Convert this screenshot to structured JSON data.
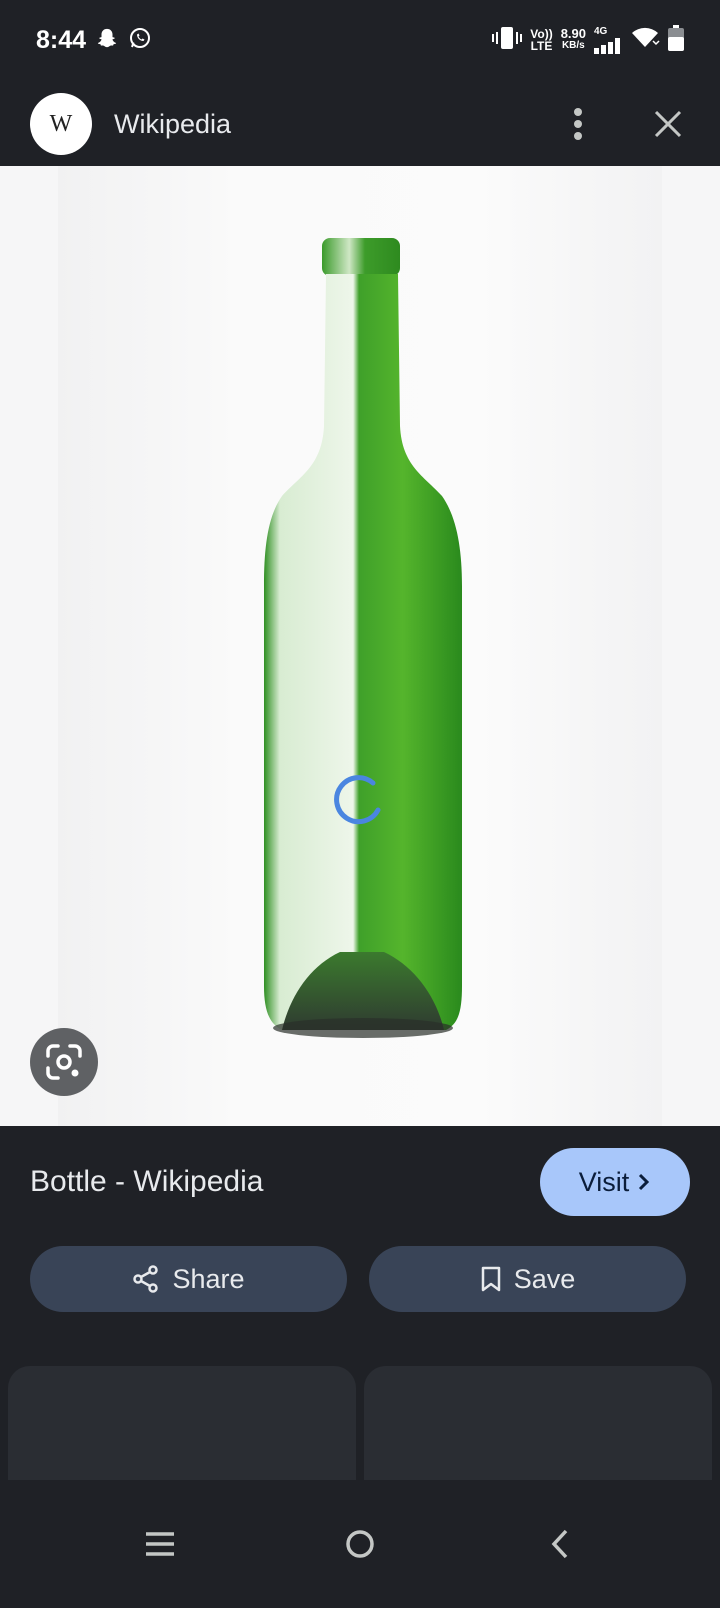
{
  "status_bar": {
    "time": "8:44",
    "network_top": "Vo))",
    "network_bottom": "LTE",
    "speed_value": "8.90",
    "speed_unit": "KB/s",
    "network_gen": "4G"
  },
  "header": {
    "logo_letter": "W",
    "site_name": "Wikipedia"
  },
  "image": {
    "loading": true
  },
  "result": {
    "title": "Bottle - Wikipedia",
    "visit_label": "Visit"
  },
  "actions": {
    "share_label": "Share",
    "save_label": "Save"
  },
  "colors": {
    "background": "#1f2126",
    "accent_button": "#a8c7fa",
    "action_button": "#394457",
    "spinner": "#4a86e0"
  },
  "icons": [
    "snapchat-icon",
    "whatsapp-icon",
    "vibrate-icon",
    "signal-icon",
    "wifi-icon",
    "battery-icon",
    "more-vert-icon",
    "close-icon",
    "google-lens-icon",
    "chevron-right-icon",
    "share-icon",
    "bookmark-icon",
    "menu-icon",
    "home-icon",
    "back-icon"
  ]
}
